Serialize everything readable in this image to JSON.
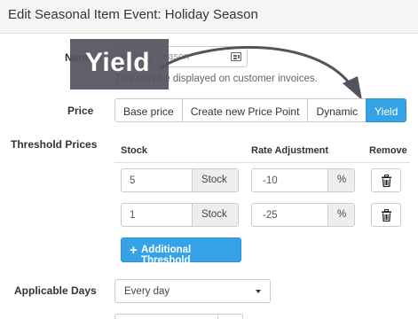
{
  "header": {
    "title": "Edit Seasonal Item Event: Holiday Season"
  },
  "name_field": {
    "label": "Name",
    "value": "Holiday Season",
    "icon": "id-card-icon",
    "helper": "This may be displayed on customer invoices."
  },
  "overlay": {
    "text": "Yield"
  },
  "price": {
    "label": "Price",
    "options": [
      "Base price",
      "Create new Price Point",
      "Dynamic",
      "Yield"
    ],
    "selected": "Yield"
  },
  "thresholds": {
    "label": "Threshold Prices",
    "columns": {
      "stock": "Stock",
      "rate": "Rate Adjustment",
      "remove": "Remove"
    },
    "rows": [
      {
        "stock": "5",
        "stock_unit": "Stock",
        "rate": "-10",
        "rate_unit": "%"
      },
      {
        "stock": "1",
        "stock_unit": "Stock",
        "rate": "-25",
        "rate_unit": "%"
      }
    ],
    "add_button": "Additional Threshold"
  },
  "applicable_days": {
    "label": "Applicable Days",
    "value": "Every day"
  },
  "colors": {
    "accent": "#36a3e6",
    "overlay": "#545460"
  }
}
